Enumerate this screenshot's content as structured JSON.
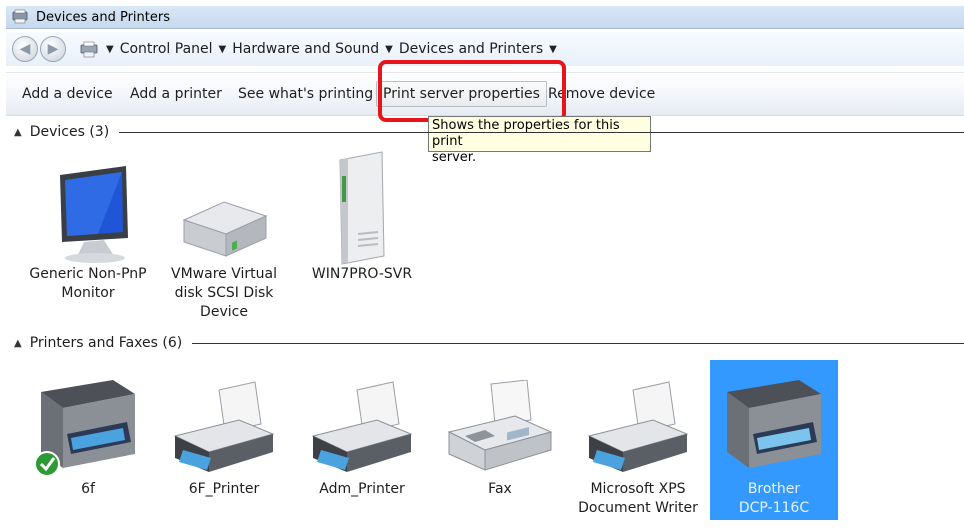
{
  "window": {
    "title": "Devices and Printers"
  },
  "address": {
    "breadcrumbs": [
      "Control Panel",
      "Hardware and Sound",
      "Devices and Printers"
    ]
  },
  "toolbar": {
    "add_device": "Add a device",
    "add_printer": "Add a printer",
    "see_printing": "See what's printing",
    "print_server": "Print server properties",
    "remove_device": "Remove device"
  },
  "tooltip": {
    "line1": "Shows the properties for this print",
    "line2": "server."
  },
  "groups": {
    "devices": {
      "title": "Devices (3)",
      "items": [
        {
          "l1": "Generic Non-PnP",
          "l2": "Monitor",
          "l3": "",
          "icon": "monitor-icon"
        },
        {
          "l1": "VMware Virtual",
          "l2": "disk SCSI Disk",
          "l3": "Device",
          "icon": "hard-disk-icon"
        },
        {
          "l1": "WIN7PRO-SVR",
          "l2": "",
          "l3": "",
          "icon": "computer-tower-icon"
        }
      ]
    },
    "printers": {
      "title": "Printers and Faxes (6)",
      "items": [
        {
          "l1": "6f",
          "l2": "",
          "icon": "multifunction-printer-icon",
          "default": true
        },
        {
          "l1": "6F_Printer",
          "l2": "",
          "icon": "printer-icon"
        },
        {
          "l1": "Adm_Printer",
          "l2": "",
          "icon": "printer-icon"
        },
        {
          "l1": "Fax",
          "l2": "",
          "icon": "fax-icon"
        },
        {
          "l1": "Microsoft XPS",
          "l2": "Document Writer",
          "icon": "printer-icon"
        },
        {
          "l1": "Brother",
          "l2": "DCP-116C",
          "icon": "multifunction-printer-icon",
          "selected": true
        }
      ]
    }
  },
  "colors": {
    "selection": "#3399ff",
    "highlight_box": "#e8141b",
    "tooltip_bg": "#ffffe1"
  }
}
